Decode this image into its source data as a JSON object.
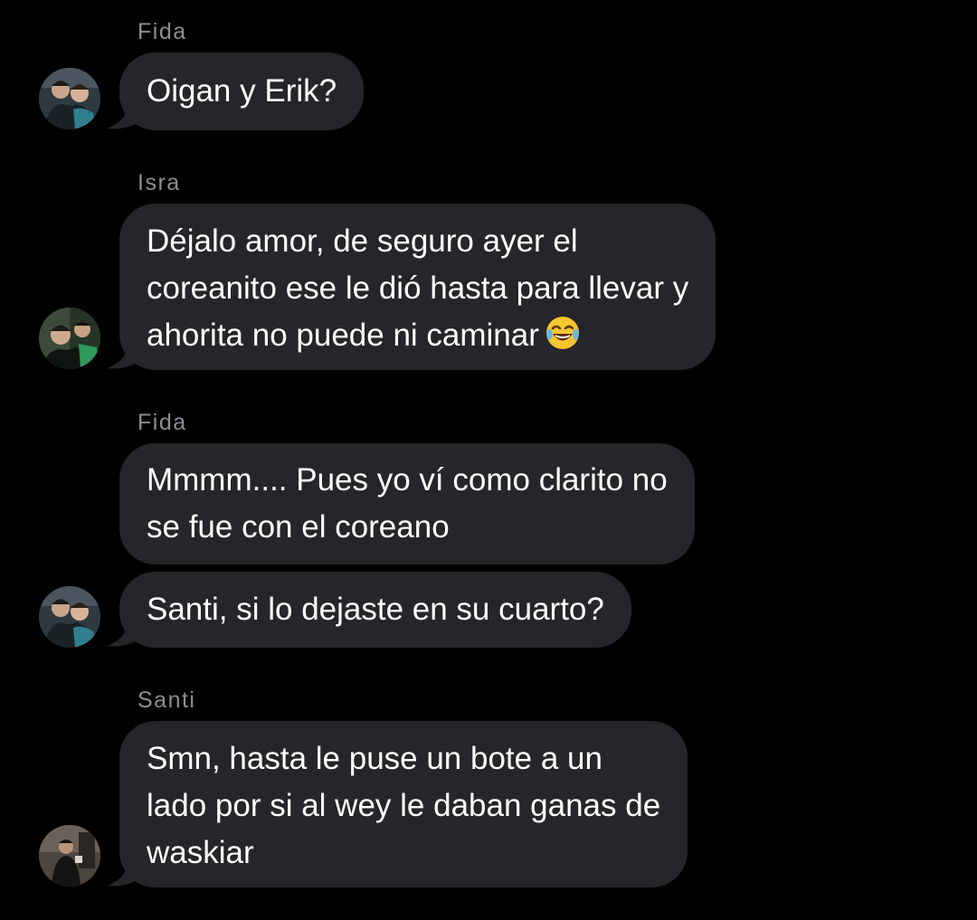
{
  "conversation": {
    "groups": [
      {
        "sender": "Fida",
        "avatar_icon": "two-men-photo-avatar",
        "messages": [
          {
            "text": "Oigan y Erik?"
          }
        ]
      },
      {
        "sender": "Isra",
        "avatar_icon": "two-men-photo-avatar",
        "messages": [
          {
            "text": "Déjalo amor, de seguro ayer el\ncoreanito ese le dió hasta para llevar y\nahorita no puede ni caminar",
            "emoji": "face-with-tears-of-joy"
          }
        ]
      },
      {
        "sender": "Fida",
        "avatar_icon": "two-men-photo-avatar",
        "messages": [
          {
            "text": "Mmmm.... Pues yo ví como clarito no\nse fue con el coreano"
          },
          {
            "text": "Santi, si lo dejaste en su cuarto?"
          }
        ]
      },
      {
        "sender": "Santi",
        "avatar_icon": "single-person-photo-avatar",
        "messages": [
          {
            "text": "Smn, hasta le puse un bote a un\nlado por si al wey le daban ganas de\nwaskiar"
          }
        ]
      }
    ]
  },
  "colors": {
    "background": "#000000",
    "bubble": "#262529",
    "sender_label": "#8e8e93",
    "message_text": "#ffffff"
  }
}
